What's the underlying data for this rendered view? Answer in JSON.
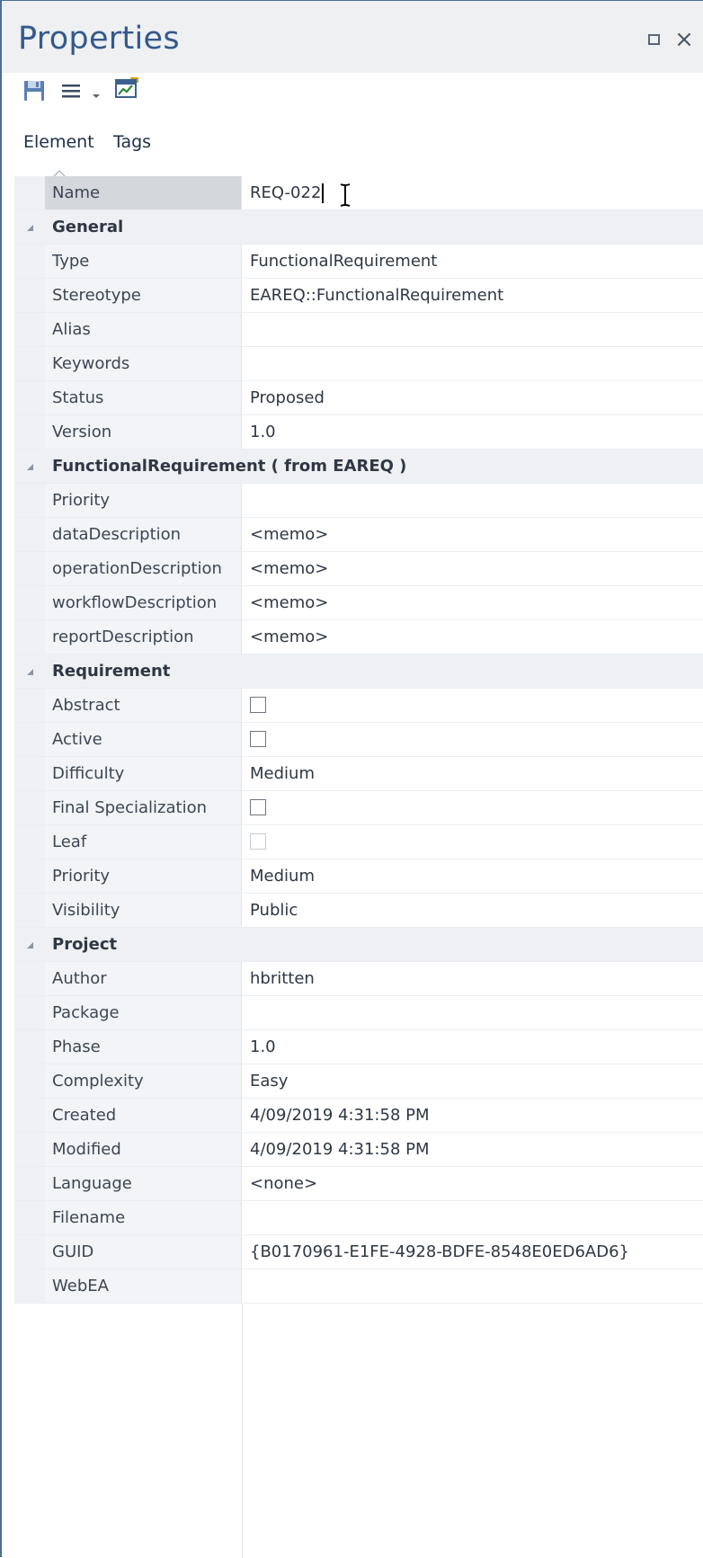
{
  "panel": {
    "title": "Properties",
    "maximize_icon": "maximize-icon",
    "close_glyph": "×"
  },
  "toolbar": {
    "save_icon": "save-icon",
    "menu_icon": "menu-lines-icon",
    "dropdown_icon": "dropdown-arrow-icon",
    "chart_icon": "properties-chart-icon"
  },
  "tabs": [
    {
      "label": "Element",
      "active": true
    },
    {
      "label": "Tags",
      "active": false
    }
  ],
  "name_row": {
    "label": "Name",
    "value": "REQ-022"
  },
  "sections": [
    {
      "title": "General",
      "rows": [
        {
          "label": "Type",
          "value": "FunctionalRequirement"
        },
        {
          "label": "Stereotype",
          "value": "EAREQ::FunctionalRequirement"
        },
        {
          "label": "Alias",
          "value": ""
        },
        {
          "label": "Keywords",
          "value": ""
        },
        {
          "label": "Status",
          "value": "Proposed"
        },
        {
          "label": "Version",
          "value": "1.0"
        }
      ]
    },
    {
      "title": "FunctionalRequirement  ( from EAREQ )",
      "rows": [
        {
          "label": "Priority",
          "value": ""
        },
        {
          "label": "dataDescription",
          "value": "<memo>"
        },
        {
          "label": "operationDescription",
          "value": "<memo>"
        },
        {
          "label": "workflowDescription",
          "value": "<memo>"
        },
        {
          "label": "reportDescription",
          "value": "<memo>"
        }
      ]
    },
    {
      "title": "Requirement",
      "rows": [
        {
          "label": "Abstract",
          "checkbox": true,
          "checked": false
        },
        {
          "label": "Active",
          "checkbox": true,
          "checked": false
        },
        {
          "label": "Difficulty",
          "value": "Medium"
        },
        {
          "label": "Final Specialization",
          "checkbox": true,
          "checked": false
        },
        {
          "label": "Leaf",
          "checkbox": true,
          "checked": false,
          "disabled": true
        },
        {
          "label": "Priority",
          "value": "Medium"
        },
        {
          "label": "Visibility",
          "value": "Public"
        }
      ]
    },
    {
      "title": "Project",
      "rows": [
        {
          "label": "Author",
          "value": "hbritten"
        },
        {
          "label": "Package",
          "value": ""
        },
        {
          "label": "Phase",
          "value": "1.0"
        },
        {
          "label": "Complexity",
          "value": "Easy"
        },
        {
          "label": "Created",
          "value": "4/09/2019 4:31:58 PM"
        },
        {
          "label": "Modified",
          "value": "4/09/2019 4:31:58 PM"
        },
        {
          "label": "Language",
          "value": "<none>"
        },
        {
          "label": "Filename",
          "value": ""
        },
        {
          "label": "GUID",
          "value": "{B0170961-E1FE-4928-BDFE-8548E0ED6AD6}"
        },
        {
          "label": "WebEA",
          "value": ""
        }
      ]
    }
  ],
  "colors": {
    "title": "#34598c",
    "border": "#4b6e9c",
    "section_bg": "#eef0f3",
    "selected_name_bg": "#d4d7dc"
  }
}
